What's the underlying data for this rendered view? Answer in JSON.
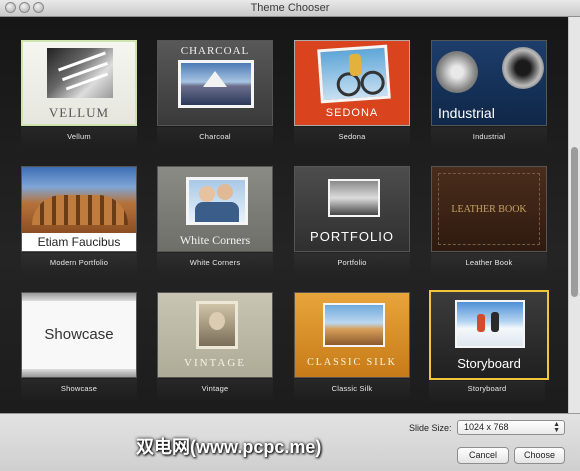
{
  "window": {
    "title": "Theme Chooser"
  },
  "themes": [
    {
      "name": "Vellum",
      "thumb_title": "VELLUM"
    },
    {
      "name": "Charcoal",
      "thumb_title": "CHARCOAL"
    },
    {
      "name": "Sedona",
      "thumb_title": "SEDONA"
    },
    {
      "name": "Industrial",
      "thumb_title": "Industrial"
    },
    {
      "name": "Modern Portfolio",
      "thumb_title": "Etiam Faucibus"
    },
    {
      "name": "White Corners",
      "thumb_title": "White Corners"
    },
    {
      "name": "Portfolio",
      "thumb_title": "PORTFOLIO"
    },
    {
      "name": "Leather Book",
      "thumb_title": "LEATHER BOOK"
    },
    {
      "name": "Showcase",
      "thumb_title": "Showcase"
    },
    {
      "name": "Vintage",
      "thumb_title": "VINTAGE"
    },
    {
      "name": "Classic Silk",
      "thumb_title": "CLASSIC SILK"
    },
    {
      "name": "Storyboard",
      "thumb_title": "Storyboard"
    }
  ],
  "selected_theme": "Storyboard",
  "footer": {
    "slide_size_label": "Slide Size:",
    "slide_size_value": "1024 x 768",
    "cancel_label": "Cancel",
    "choose_label": "Choose",
    "watermark": "双电网(www.pcpc.me)"
  },
  "colors": {
    "selection": "#f2c53d",
    "sedona_bg": "#d9431e",
    "industrial_bg": "#1d3d6b"
  }
}
